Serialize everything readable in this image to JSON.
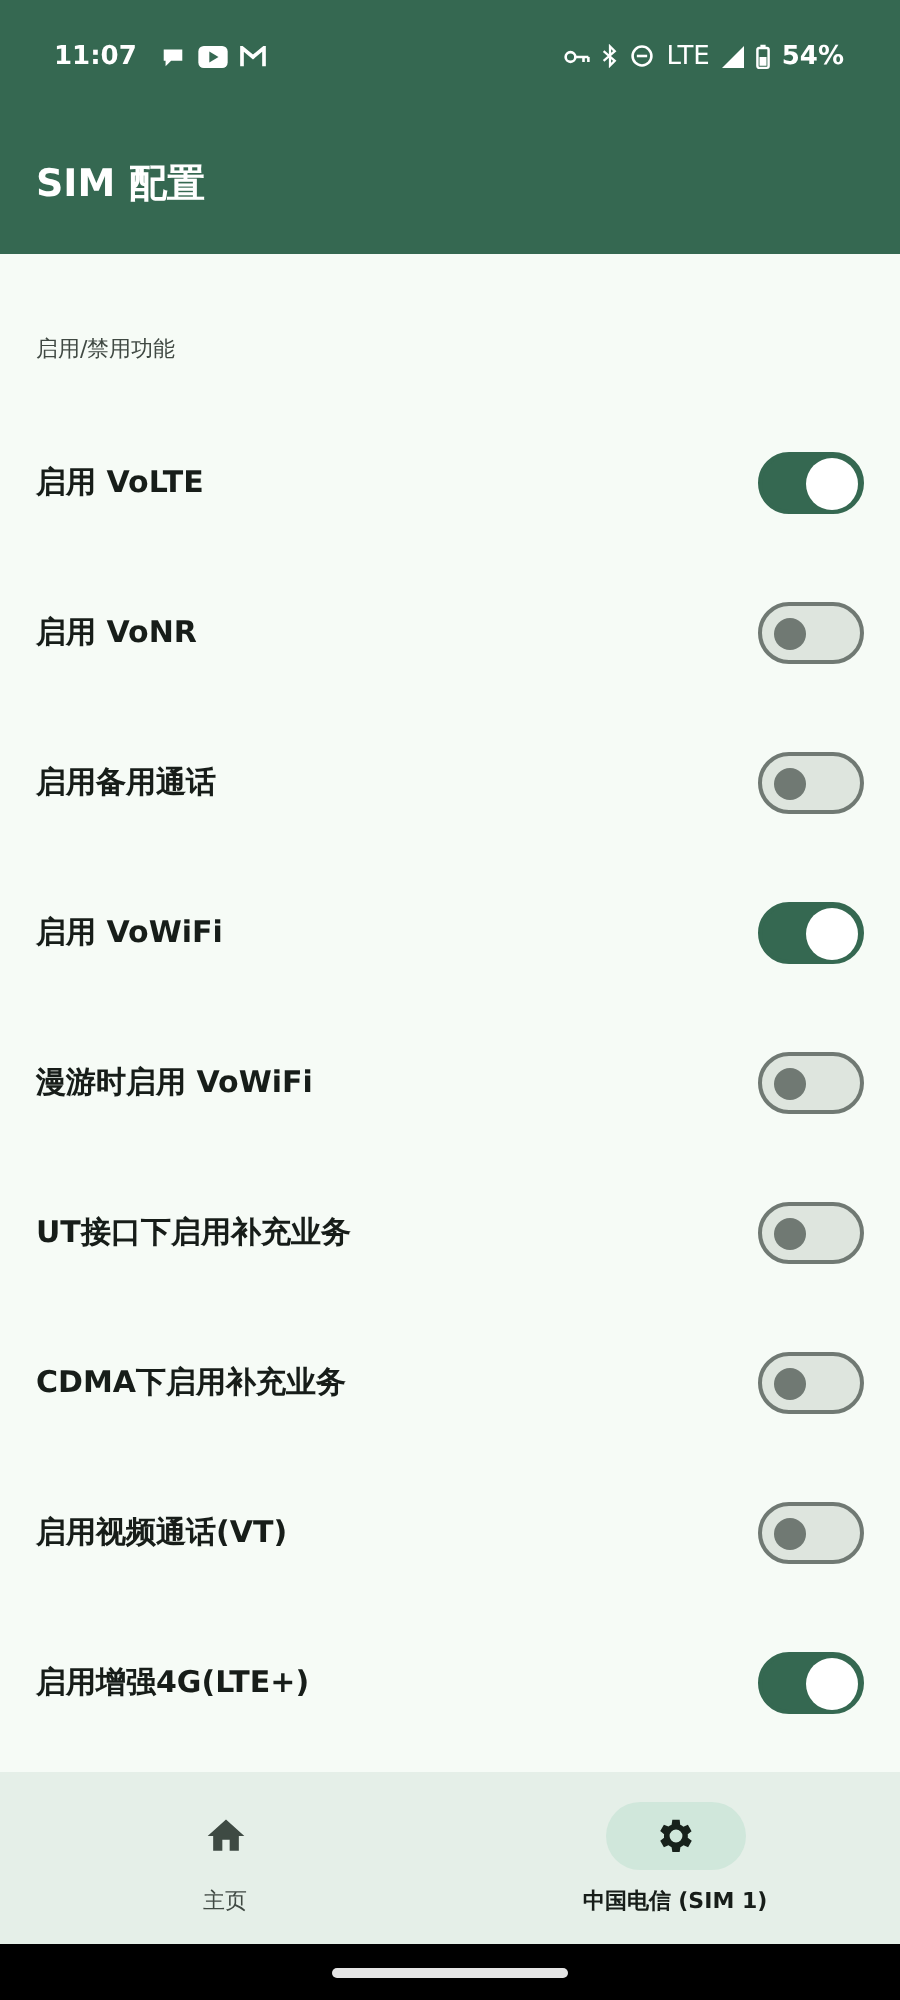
{
  "status_bar": {
    "time": "11:07",
    "network": "LTE",
    "battery": "54%"
  },
  "app_bar": {
    "title": "SIM 配置"
  },
  "section": {
    "title": "启用/禁用功能"
  },
  "settings": [
    {
      "label": "启用 VoLTE",
      "on": true
    },
    {
      "label": "启用 VoNR",
      "on": false
    },
    {
      "label": "启用备用通话",
      "on": false
    },
    {
      "label": "启用 VoWiFi",
      "on": true
    },
    {
      "label": "漫游时启用 VoWiFi",
      "on": false
    },
    {
      "label": "UT接口下启用补充业务",
      "on": false
    },
    {
      "label": "CDMA下启用补充业务",
      "on": false
    },
    {
      "label": "启用视频通话(VT)",
      "on": false
    },
    {
      "label": "启用增强4G(LTE+)",
      "on": true
    }
  ],
  "nav": [
    {
      "label": "主页",
      "kind": "home",
      "selected": false
    },
    {
      "label": "中国电信 (SIM 1)",
      "kind": "settings",
      "selected": true
    }
  ]
}
